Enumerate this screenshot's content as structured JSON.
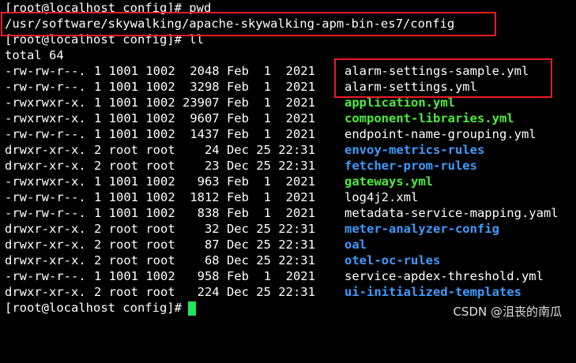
{
  "terminal": {
    "line_pwd_cmd": "[root@localhost config]# pwd",
    "line_pwd_out": "/usr/software/skywalking/apache-skywalking-apm-bin-es7/config",
    "line_ll_cmd": "[root@localhost config]# ll",
    "line_total": "total 64",
    "final_prompt": "[root@localhost config]#"
  },
  "listing": [
    {
      "perm": "-rw-rw-r--.",
      "meta": "1 1001 1002  2048 Feb  1  2021",
      "name": "alarm-settings-sample.yml",
      "kind": "plain"
    },
    {
      "perm": "-rw-rw-r--.",
      "meta": "1 1001 1002  3298 Feb  1  2021",
      "name": "alarm-settings.yml",
      "kind": "plain"
    },
    {
      "perm": "-rwxrwxr-x.",
      "meta": "1 1001 1002 23907 Feb  1  2021",
      "name": "application.yml",
      "kind": "exec"
    },
    {
      "perm": "-rwxrwxr-x.",
      "meta": "1 1001 1002  9607 Feb  1  2021",
      "name": "component-libraries.yml",
      "kind": "exec"
    },
    {
      "perm": "-rw-rw-r--.",
      "meta": "1 1001 1002  1437 Feb  1  2021",
      "name": "endpoint-name-grouping.yml",
      "kind": "plain"
    },
    {
      "perm": "drwxr-xr-x.",
      "meta": "2 root root    24 Dec 25 22:31",
      "name": "envoy-metrics-rules",
      "kind": "dir"
    },
    {
      "perm": "drwxr-xr-x.",
      "meta": "2 root root    23 Dec 25 22:31",
      "name": "fetcher-prom-rules",
      "kind": "dir"
    },
    {
      "perm": "-rwxrwxr-x.",
      "meta": "1 1001 1002   963 Feb  1  2021",
      "name": "gateways.yml",
      "kind": "exec"
    },
    {
      "perm": "-rw-rw-r--.",
      "meta": "1 1001 1002  1812 Feb  1  2021",
      "name": "log4j2.xml",
      "kind": "plain"
    },
    {
      "perm": "-rw-rw-r--.",
      "meta": "1 1001 1002   838 Feb  1  2021",
      "name": "metadata-service-mapping.yaml",
      "kind": "plain"
    },
    {
      "perm": "drwxr-xr-x.",
      "meta": "2 root root    32 Dec 25 22:31",
      "name": "meter-analyzer-config",
      "kind": "dir"
    },
    {
      "perm": "drwxr-xr-x.",
      "meta": "2 root root    87 Dec 25 22:31",
      "name": "oal",
      "kind": "dir"
    },
    {
      "perm": "drwxr-xr-x.",
      "meta": "2 root root    68 Dec 25 22:31",
      "name": "otel-oc-rules",
      "kind": "dir"
    },
    {
      "perm": "-rw-rw-r--.",
      "meta": "1 1001 1002   958 Feb  1  2021",
      "name": "service-apdex-threshold.yml",
      "kind": "plain"
    },
    {
      "perm": "drwxr-xr-x.",
      "meta": "2 root root   224 Dec 25 22:31",
      "name": "ui-initialized-templates",
      "kind": "dir"
    }
  ],
  "watermark": "CSDN @沮丧的南瓜",
  "colors": {
    "background": "#000000",
    "text": "#ffffff",
    "executable": "#4cee3c",
    "directory": "#3d9cff",
    "cursor": "#1ee65a",
    "highlight_box": "#ec1c24"
  }
}
